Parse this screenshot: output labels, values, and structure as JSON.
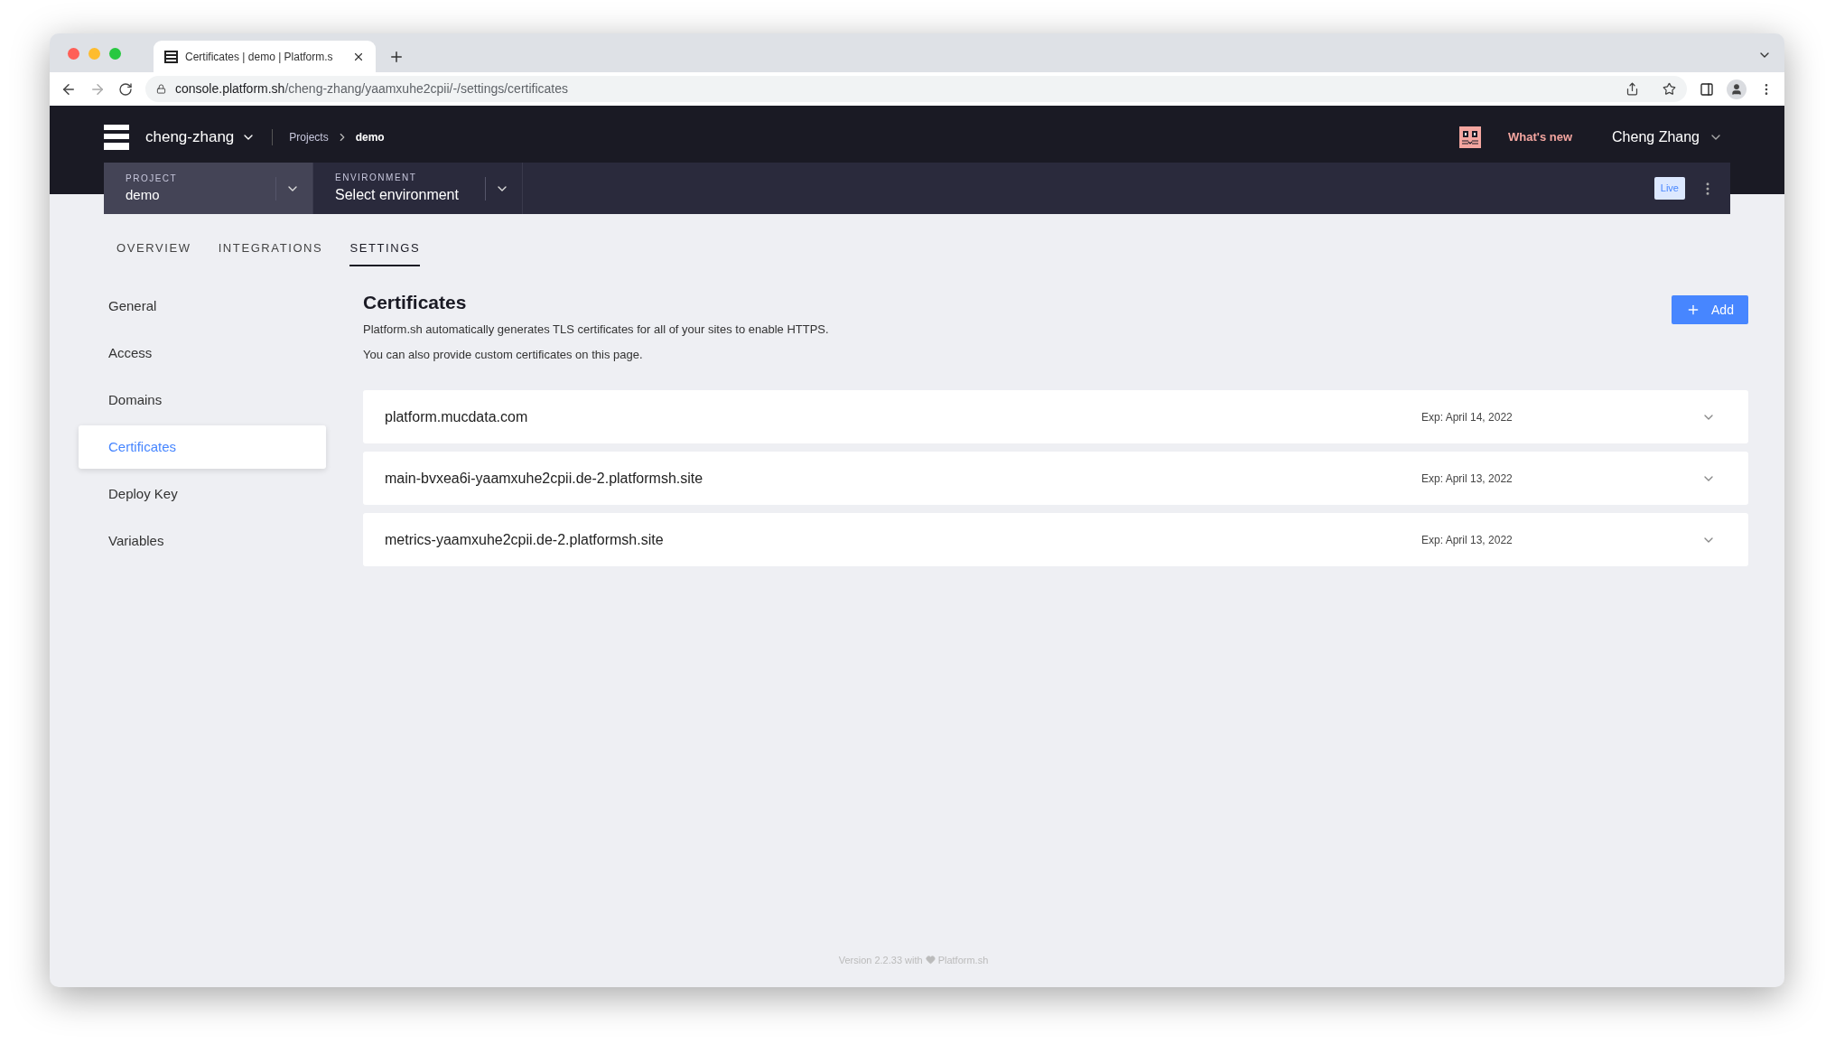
{
  "browser": {
    "tab_title": "Certificates | demo | Platform.s",
    "url_host": "console.platform.sh",
    "url_path": "/cheng-zhang/yaamxuhe2cpii/-/settings/certificates"
  },
  "header": {
    "org": "cheng-zhang",
    "breadcrumbs": [
      {
        "label": "Projects",
        "current": false
      },
      {
        "label": "demo",
        "current": true
      }
    ],
    "whats_new": "What's new",
    "user": "Cheng Zhang"
  },
  "selectors": [
    {
      "label": "PROJECT",
      "value": "demo",
      "selected": true
    },
    {
      "label": "ENVIRONMENT",
      "value": "Select environment",
      "selected": false
    }
  ],
  "badge": "Live",
  "tabs": [
    {
      "label": "OVERVIEW",
      "selected": false
    },
    {
      "label": "INTEGRATIONS",
      "selected": false
    },
    {
      "label": "SETTINGS",
      "selected": true
    }
  ],
  "sidebar": {
    "items": [
      {
        "label": "General",
        "selected": false
      },
      {
        "label": "Access",
        "selected": false
      },
      {
        "label": "Domains",
        "selected": false
      },
      {
        "label": "Certificates",
        "selected": true
      },
      {
        "label": "Deploy Key",
        "selected": false
      },
      {
        "label": "Variables",
        "selected": false
      }
    ]
  },
  "content": {
    "title": "Certificates",
    "add_button": "Add",
    "description": [
      "Platform.sh automatically generates TLS certificates for all of your sites to enable HTTPS.",
      "You can also provide custom certificates on this page."
    ],
    "certificates": [
      {
        "domain": "platform.mucdata.com",
        "expiry": "Exp: April 14, 2022",
        "expanded": false
      },
      {
        "domain": "main-bvxea6i-yaamxuhe2cpii.de-2.platformsh.site",
        "expiry": "Exp: April 13, 2022",
        "expanded": false
      },
      {
        "domain": "metrics-yaamxuhe2cpii.de-2.platformsh.site",
        "expiry": "Exp: April 13, 2022",
        "expanded": false
      }
    ]
  },
  "footer": {
    "prefix": "Version 2.2.33 with",
    "suffix": "Platform.sh"
  }
}
